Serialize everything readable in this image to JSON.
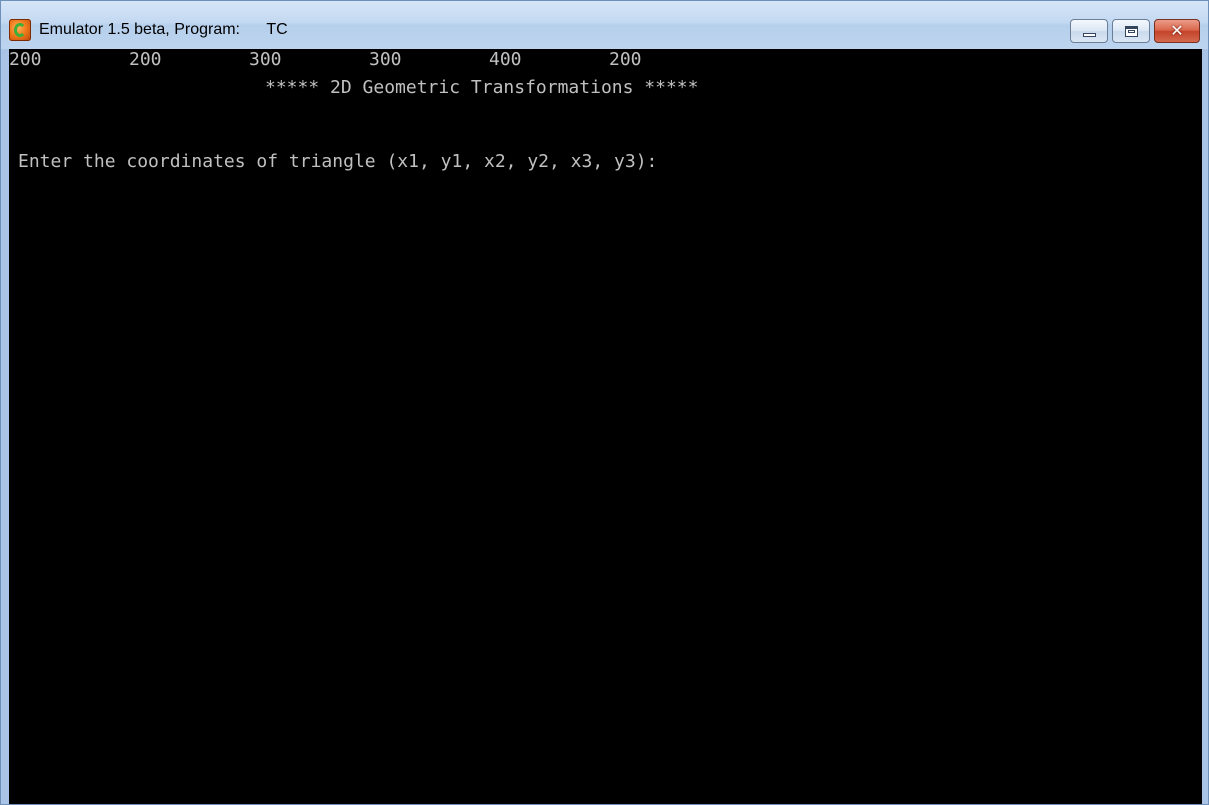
{
  "window": {
    "title": "Emulator 1.5 beta, Program:",
    "program": "TC",
    "icon": "turbo-c-emulator-icon",
    "buttons": {
      "minimize": "minimize-icon",
      "maximize": "maximize-icon",
      "close": "close-icon",
      "close_glyph": "✕"
    }
  },
  "console": {
    "banner": "***** 2D Geometric Transformations *****",
    "prompt": "Enter the coordinates of triangle (x1, y1, x2, y2, x3, y3):",
    "inputs": [
      "200",
      "200",
      "300",
      "300",
      "400",
      "200"
    ],
    "colors": {
      "background": "#000000",
      "text": "#c0c0c0"
    }
  }
}
